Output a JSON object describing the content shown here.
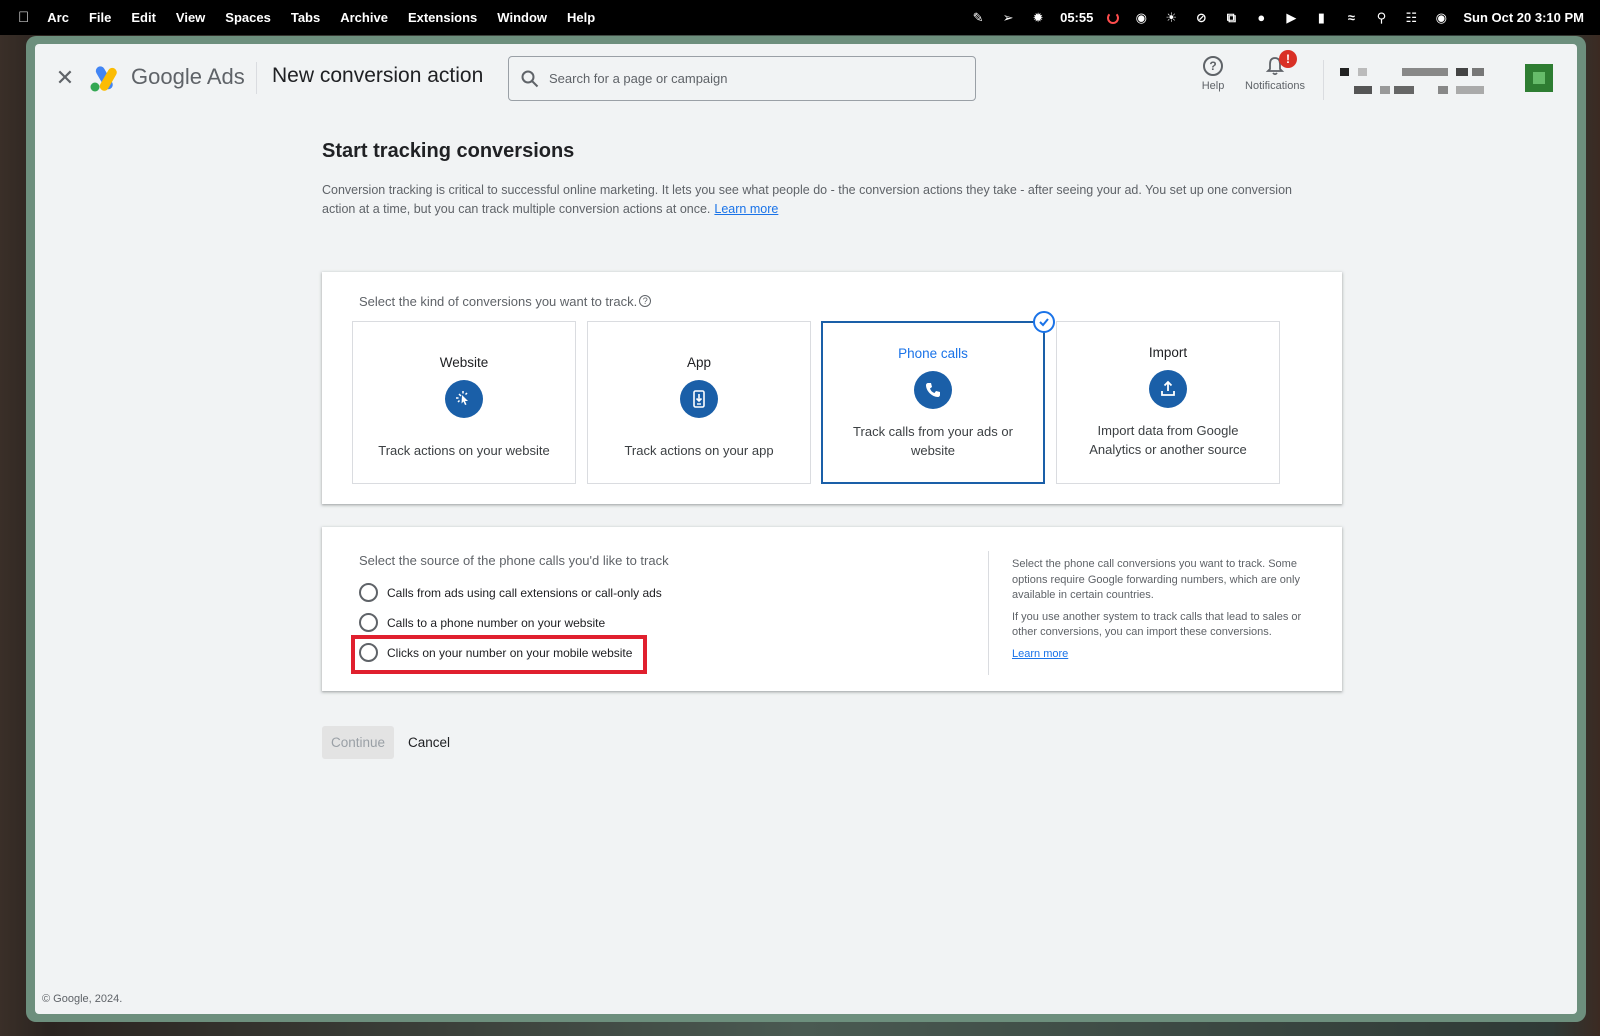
{
  "menubar": {
    "app": "Arc",
    "items": [
      "File",
      "Edit",
      "View",
      "Spaces",
      "Tabs",
      "Archive",
      "Extensions",
      "Window",
      "Help"
    ],
    "timer": "05:55",
    "datetime": "Sun Oct 20  3:10 PM"
  },
  "header": {
    "brand": "Google Ads",
    "page_title": "New conversion action",
    "search_placeholder": "Search for a page or campaign",
    "help_label": "Help",
    "notifications_label": "Notifications",
    "notifications_badge": "!"
  },
  "main": {
    "title": "Start tracking conversions",
    "intro": "Conversion tracking is critical to successful online marketing. It lets you see what people do - the conversion actions they take - after seeing your ad. You set up one conversion action at a time, but you can track multiple conversion actions at once.",
    "intro_link": "Learn more",
    "kind_label": "Select the kind of conversions you want to track.",
    "options": [
      {
        "title": "Website",
        "desc": "Track actions on your website",
        "icon": "cursor-click-icon"
      },
      {
        "title": "App",
        "desc": "Track actions on your app",
        "icon": "phone-download-icon"
      },
      {
        "title": "Phone calls",
        "desc": "Track calls from your ads or website",
        "icon": "phone-icon",
        "selected": true
      },
      {
        "title": "Import",
        "desc": "Import data from Google Analytics or another source",
        "icon": "upload-icon"
      }
    ],
    "source_label": "Select the source of the phone calls you'd like to track",
    "sources": [
      "Calls from ads using call extensions or call-only ads",
      "Calls to a phone number on your website",
      "Clicks on your number on your mobile website"
    ],
    "side_info_1": "Select the phone call conversions you want to track. Some options require Google forwarding numbers, which are only available in certain countries.",
    "side_info_2": "If you use another system to track calls that lead to sales or other conversions, you can import these conversions.",
    "side_link": "Learn more",
    "continue_label": "Continue",
    "cancel_label": "Cancel"
  },
  "footer": "© Google, 2024.",
  "colors": {
    "accent": "#1a73e8",
    "icon_bg": "#1a5fa8",
    "highlight": "#e0202e"
  }
}
